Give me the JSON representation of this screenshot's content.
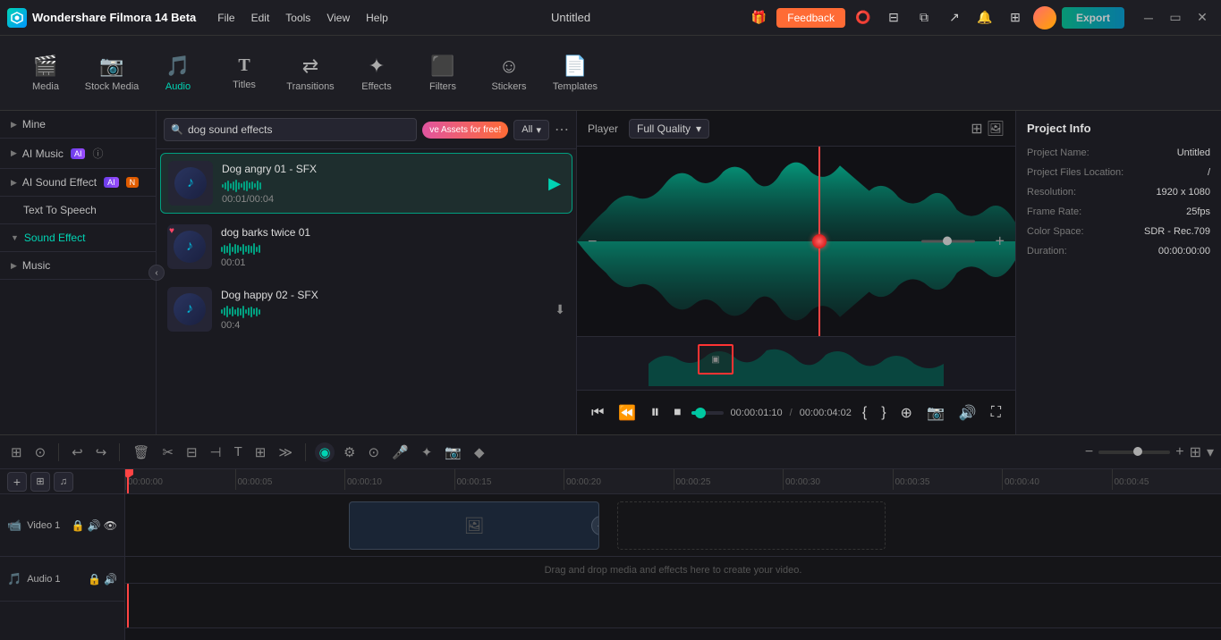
{
  "app": {
    "name": "Wondershare Filmora 14 Beta",
    "logo_char": "W"
  },
  "menu": {
    "items": [
      "File",
      "Edit",
      "Tools",
      "View",
      "Help"
    ]
  },
  "window_title": "Untitled",
  "feedback_btn": "Feedback",
  "export_btn": "Export",
  "toolbar": {
    "items": [
      {
        "id": "media",
        "label": "Media",
        "icon": "🎬"
      },
      {
        "id": "stock-media",
        "label": "Stock Media",
        "icon": "📷"
      },
      {
        "id": "audio",
        "label": "Audio",
        "icon": "🎵",
        "active": true
      },
      {
        "id": "titles",
        "label": "Titles",
        "icon": "T"
      },
      {
        "id": "transitions",
        "label": "Transitions",
        "icon": "↔"
      },
      {
        "id": "effects",
        "label": "Effects",
        "icon": "✨"
      },
      {
        "id": "filters",
        "label": "Filters",
        "icon": "🔲"
      },
      {
        "id": "stickers",
        "label": "Stickers",
        "icon": "⭐"
      },
      {
        "id": "templates",
        "label": "Templates",
        "icon": "📄"
      }
    ]
  },
  "sidebar": {
    "items": [
      {
        "id": "mine",
        "label": "Mine",
        "expandable": true
      },
      {
        "id": "ai-music",
        "label": "AI Music",
        "badge": "AI",
        "expandable": true,
        "has_info": true
      },
      {
        "id": "ai-sound-effect",
        "label": "AI Sound Effect",
        "badge": "AI",
        "expandable": true,
        "new_badge": true
      },
      {
        "id": "text-to-speech",
        "label": "Text To Speech",
        "expandable": false
      },
      {
        "id": "sound-effect",
        "label": "Sound Effect",
        "expandable": true,
        "active": true
      },
      {
        "id": "music",
        "label": "Music",
        "expandable": true
      }
    ]
  },
  "audio_panel": {
    "search_placeholder": "dog sound effects",
    "search_value": "dog sound effects",
    "promo_text": "ve Assets for free!",
    "filter_label": "All",
    "items": [
      {
        "id": "dog-angry-01",
        "title": "Dog angry 01 - SFX",
        "duration": "00:01/00:04",
        "active": true
      },
      {
        "id": "dog-barks-twice-01",
        "title": "dog barks twice 01",
        "duration": "00:01",
        "has_heart": true
      },
      {
        "id": "dog-happy-02",
        "title": "Dog happy 02 - SFX",
        "duration": "00:4",
        "has_download": true
      }
    ]
  },
  "player": {
    "label": "Player",
    "quality": "Full Quality",
    "current_time": "00:00:01:10",
    "total_time": "00:00:04:02",
    "progress_pct": 27
  },
  "project_info": {
    "title": "Project Info",
    "name_label": "Project Name:",
    "name_value": "Untitled",
    "files_label": "Project Files Location:",
    "files_value": "/",
    "resolution_label": "Resolution:",
    "resolution_value": "1920 x 1080",
    "frame_rate_label": "Frame Rate:",
    "frame_rate_value": "25fps",
    "color_space_label": "Color Space:",
    "color_space_value": "SDR - Rec.709",
    "duration_label": "Duration:",
    "duration_value": "00:00:00:00"
  },
  "timeline": {
    "ruler_marks": [
      "00:00:00",
      "00:00:05",
      "00:00:10",
      "00:00:15",
      "00:00:20",
      "00:00:25",
      "00:00:30",
      "00:00:35",
      "00:00:40",
      "00:00:45"
    ],
    "tracks": [
      {
        "id": "video-1",
        "label": "Video 1",
        "type": "video"
      },
      {
        "id": "audio-1",
        "label": "Audio 1",
        "type": "audio"
      }
    ],
    "drop_hint": "Drag and drop media and effects here to create your video."
  }
}
